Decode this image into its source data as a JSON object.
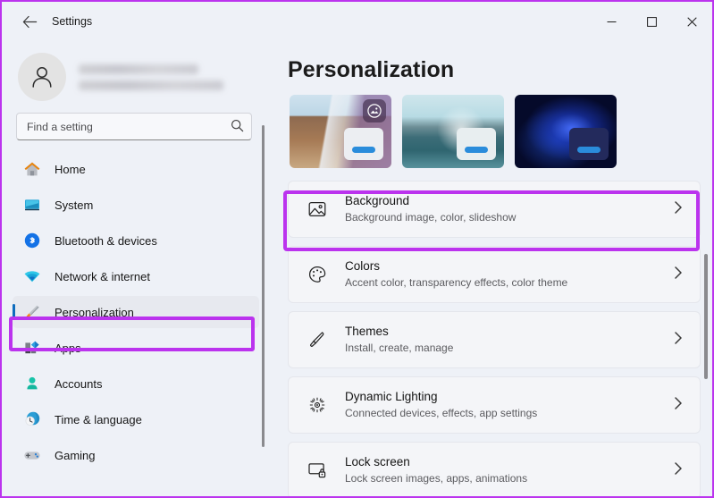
{
  "window": {
    "titlebar_title": "Settings",
    "back_icon": "back-arrow-icon",
    "minimize_label": "–",
    "maximize_label": "□",
    "close_label": "✕",
    "accent_highlight_color": "#bb33ee",
    "selection_indicator_color": "#0f6cbd",
    "background_color": "#eef1f7"
  },
  "sidebar": {
    "account": {
      "name_redacted": "",
      "email_redacted": "",
      "avatar_icon": "person-avatar-icon"
    },
    "search": {
      "placeholder": "Find a setting",
      "value": "",
      "icon": "search-icon"
    },
    "items": [
      {
        "label": "Home",
        "icon": "home-icon",
        "selected": false
      },
      {
        "label": "System",
        "icon": "system-icon",
        "selected": false
      },
      {
        "label": "Bluetooth & devices",
        "icon": "bluetooth-icon",
        "selected": false
      },
      {
        "label": "Network & internet",
        "icon": "network-wifi-icon",
        "selected": false
      },
      {
        "label": "Personalization",
        "icon": "paintbrush-icon",
        "selected": true
      },
      {
        "label": "Apps",
        "icon": "apps-icon",
        "selected": false
      },
      {
        "label": "Accounts",
        "icon": "accounts-person-icon",
        "selected": false
      },
      {
        "label": "Time & language",
        "icon": "clock-globe-icon",
        "selected": false
      },
      {
        "label": "Gaming",
        "icon": "gamepad-icon",
        "selected": false
      }
    ]
  },
  "main": {
    "page_title": "Personalization",
    "theme_thumbnails": [
      {
        "name": "theme-preview-1",
        "selected": true,
        "badge_icon": "image-icon"
      },
      {
        "name": "theme-preview-2",
        "selected": false,
        "badge_icon": ""
      },
      {
        "name": "theme-preview-3",
        "selected": false,
        "badge_icon": ""
      }
    ],
    "cards": [
      {
        "title": "Background",
        "subtitle": "Background image, color, slideshow",
        "icon": "image-picture-icon",
        "chevron": "chevron-right-icon",
        "highlighted": true
      },
      {
        "title": "Colors",
        "subtitle": "Accent color, transparency effects, color theme",
        "icon": "palette-icon",
        "chevron": "chevron-right-icon",
        "highlighted": false
      },
      {
        "title": "Themes",
        "subtitle": "Install, create, manage",
        "icon": "paintbrush-icon",
        "chevron": "chevron-right-icon",
        "highlighted": false
      },
      {
        "title": "Dynamic Lighting",
        "subtitle": "Connected devices, effects, app settings",
        "icon": "sunburst-light-icon",
        "chevron": "chevron-right-icon",
        "highlighted": false
      },
      {
        "title": "Lock screen",
        "subtitle": "Lock screen images, apps, animations",
        "icon": "lock-screen-icon",
        "chevron": "chevron-right-icon",
        "highlighted": false
      }
    ]
  }
}
